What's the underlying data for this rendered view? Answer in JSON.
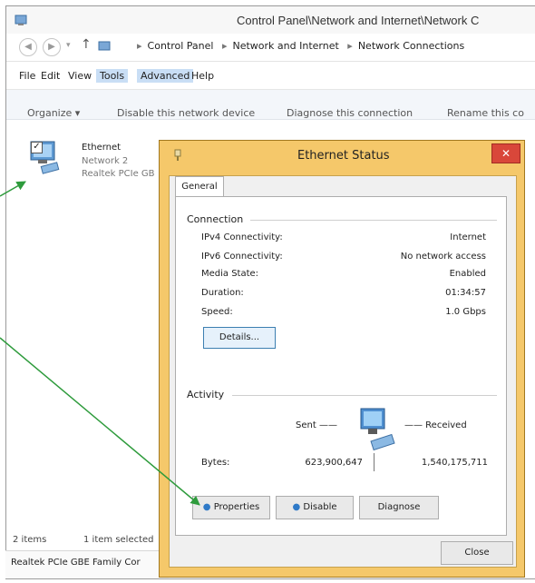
{
  "explorer": {
    "title": "Control Panel\\Network and Internet\\Network C",
    "breadcrumb": [
      "Control Panel",
      "Network and Internet",
      "Network Connections"
    ],
    "menu": [
      "File",
      "Edit",
      "View",
      "Tools",
      "Advanced",
      "Help"
    ],
    "commands": [
      "Organize ▾",
      "Disable this network device",
      "Diagnose this connection",
      "Rename this co"
    ],
    "item": {
      "name": "Ethernet",
      "network": "Network 2",
      "adapter": "Realtek PCIe GB"
    },
    "status": {
      "count": "2 items",
      "selected": "1 item selected"
    },
    "details": "Realtek PCIe GBE Family Cor"
  },
  "dialog": {
    "title": "Ethernet Status",
    "close": "✕",
    "tab": "General",
    "connection": {
      "heading": "Connection",
      "rows": [
        {
          "label": "IPv4 Connectivity:",
          "value": "Internet"
        },
        {
          "label": "IPv6 Connectivity:",
          "value": "No network access"
        },
        {
          "label": "Media State:",
          "value": "Enabled"
        },
        {
          "label": "Duration:",
          "value": "01:34:57"
        },
        {
          "label": "Speed:",
          "value": "1.0 Gbps"
        }
      ],
      "details_button": "Details..."
    },
    "activity": {
      "heading": "Activity",
      "sent_label": "Sent ——",
      "received_label": "——  Received",
      "bytes_label": "Bytes:",
      "sent_value": "623,900,647",
      "received_value": "1,540,175,711"
    },
    "buttons": {
      "properties": "Properties",
      "disable": "Disable",
      "diagnose": "Diagnose",
      "close": "Close"
    }
  },
  "colors": {
    "arrow": "#2e9b3c",
    "dialog_frame": "#f5c86a",
    "close_red": "#d9473a",
    "menu_highlight": "#c9def5"
  }
}
